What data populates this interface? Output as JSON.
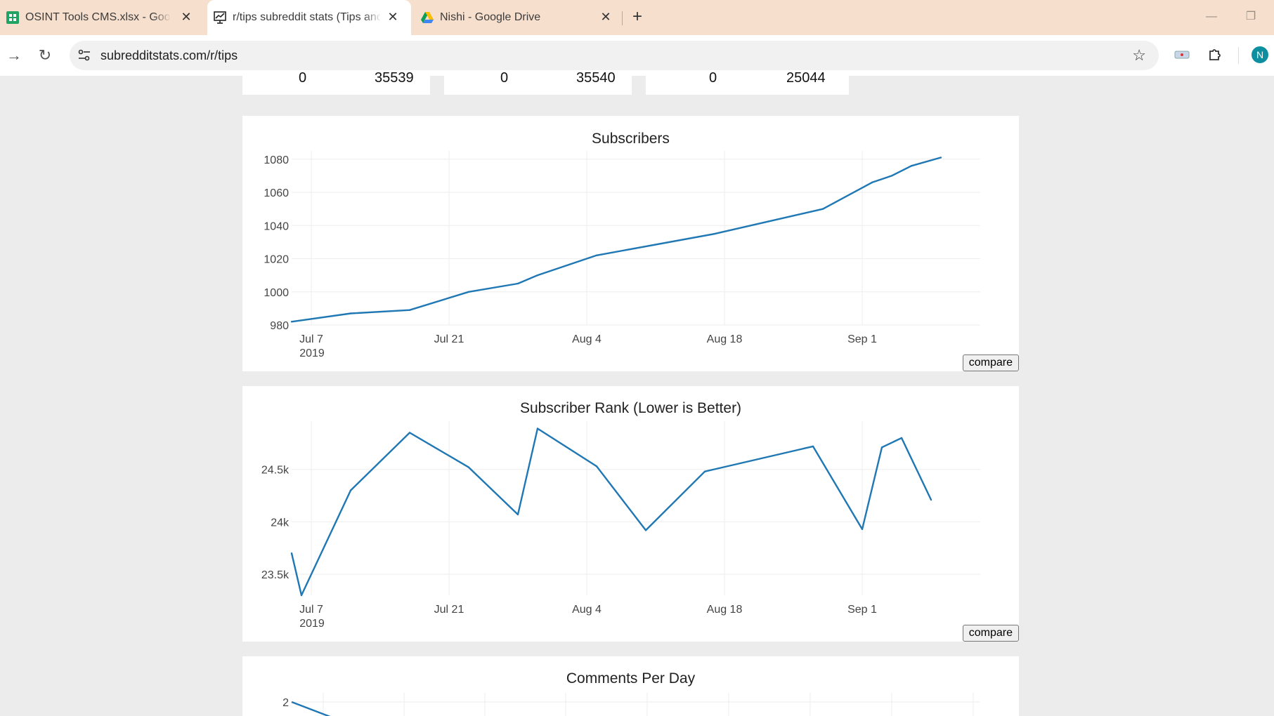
{
  "browser": {
    "tabs": [
      {
        "label": "OSINT Tools CMS.xlsx - Google",
        "icon": "sheets-icon"
      },
      {
        "label": "r/tips subreddit stats (Tips and t",
        "icon": "stats-icon"
      },
      {
        "label": "Nishi - Google Drive",
        "icon": "drive-icon"
      }
    ],
    "url": "subredditstats.com/r/tips",
    "profile_initial": "N"
  },
  "stats_row": [
    {
      "left": "0",
      "right": "35539"
    },
    {
      "left": "0",
      "right": "35540"
    },
    {
      "left": "0",
      "right": "25044"
    }
  ],
  "compare_label": "compare",
  "charts": {
    "subscribers": {
      "title": "Subscribers"
    },
    "rank": {
      "title": "Subscriber Rank (Lower is Better)"
    },
    "comments": {
      "title": "Comments Per Day"
    }
  },
  "chart_data": [
    {
      "type": "line",
      "title": "Subscribers",
      "x_type": "date",
      "x_ticks": [
        "Jul 7\n2019",
        "Jul 21",
        "Aug 4",
        "Aug 18",
        "Sep 1"
      ],
      "x_tick_dates": [
        "2019-07-07",
        "2019-07-21",
        "2019-08-04",
        "2019-08-18",
        "2019-09-01"
      ],
      "xlim": [
        "2019-07-05",
        "2019-09-13"
      ],
      "ylim": [
        980,
        1085
      ],
      "y_ticks": [
        980,
        1000,
        1020,
        1040,
        1060,
        1080
      ],
      "x": [
        "2019-07-05",
        "2019-07-11",
        "2019-07-17",
        "2019-07-23",
        "2019-07-28",
        "2019-07-30",
        "2019-08-05",
        "2019-08-17",
        "2019-08-28",
        "2019-09-02",
        "2019-09-04",
        "2019-09-06",
        "2019-09-09"
      ],
      "y": [
        982,
        987,
        989,
        1000,
        1005,
        1010,
        1022,
        1035,
        1050,
        1066,
        1070,
        1076,
        1081
      ],
      "grid": true
    },
    {
      "type": "line",
      "title": "Subscriber Rank (Lower is Better)",
      "x_type": "date",
      "x_ticks": [
        "Jul 7\n2019",
        "Jul 21",
        "Aug 4",
        "Aug 18",
        "Sep 1"
      ],
      "x_tick_dates": [
        "2019-07-07",
        "2019-07-21",
        "2019-08-04",
        "2019-08-18",
        "2019-09-01"
      ],
      "xlim": [
        "2019-07-05",
        "2019-09-13"
      ],
      "ylim": [
        23300,
        24960
      ],
      "y_ticks": [
        23500,
        24000,
        24500
      ],
      "y_tick_labels": [
        "23.5k",
        "24k",
        "24.5k"
      ],
      "x": [
        "2019-07-05",
        "2019-07-06",
        "2019-07-11",
        "2019-07-17",
        "2019-07-23",
        "2019-07-28",
        "2019-07-30",
        "2019-08-05",
        "2019-08-10",
        "2019-08-16",
        "2019-08-27",
        "2019-09-01",
        "2019-09-03",
        "2019-09-05",
        "2019-09-08"
      ],
      "y": [
        23700,
        23300,
        24300,
        24850,
        24520,
        24070,
        24890,
        24530,
        23920,
        24480,
        24720,
        23930,
        24710,
        24800,
        24210
      ],
      "grid": true
    },
    {
      "type": "line",
      "title": "Comments Per Day",
      "y_ticks": [
        2
      ],
      "x": [
        0,
        1
      ],
      "y": [
        2,
        1.8
      ],
      "grid": true,
      "note_partial": "chart cut off at bottom of viewport"
    }
  ]
}
